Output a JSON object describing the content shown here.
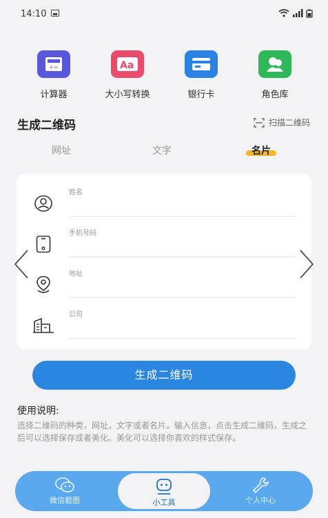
{
  "status_bar": {
    "time": "14:10"
  },
  "tools": [
    {
      "label": "计算器",
      "icon": "calculator-icon",
      "color": "#5b57dd"
    },
    {
      "label": "大小写转换",
      "icon": "text-case-icon",
      "color": "#e84b6b"
    },
    {
      "label": "银行卡",
      "icon": "bank-card-icon",
      "color": "#2a83e2"
    },
    {
      "label": "角色库",
      "icon": "characters-icon",
      "color": "#2fb85a"
    }
  ],
  "section": {
    "title": "生成二维码",
    "scan_label": "扫描二维码"
  },
  "tabs": [
    {
      "label": "网址",
      "active": false
    },
    {
      "label": "文字",
      "active": false
    },
    {
      "label": "名片",
      "active": true
    }
  ],
  "fields": [
    {
      "label": "姓名",
      "icon": "person-icon",
      "value": ""
    },
    {
      "label": "手机号码",
      "icon": "phone-icon",
      "value": ""
    },
    {
      "label": "地址",
      "icon": "location-icon",
      "value": ""
    },
    {
      "label": "公司",
      "icon": "building-icon",
      "value": ""
    }
  ],
  "generate_button": "生成二维码",
  "usage": {
    "title": "使用说明:",
    "text": "选择二维码的种类，网址，文字或者名片。输入信息，点击生成二维码，生成之后可以选择保存或者美化。美化可以选择你喜欢的样式保存。"
  },
  "bottom_nav": [
    {
      "label": "微信截图",
      "icon": "wechat-icon",
      "active": false
    },
    {
      "label": "小工具",
      "icon": "robot-icon",
      "active": true
    },
    {
      "label": "个人中心",
      "icon": "wrench-icon",
      "active": false
    }
  ],
  "colors": {
    "accent": "#2b86e2",
    "tab_highlight": "#f5b62b",
    "nav_bg": "#5aa9ee"
  }
}
